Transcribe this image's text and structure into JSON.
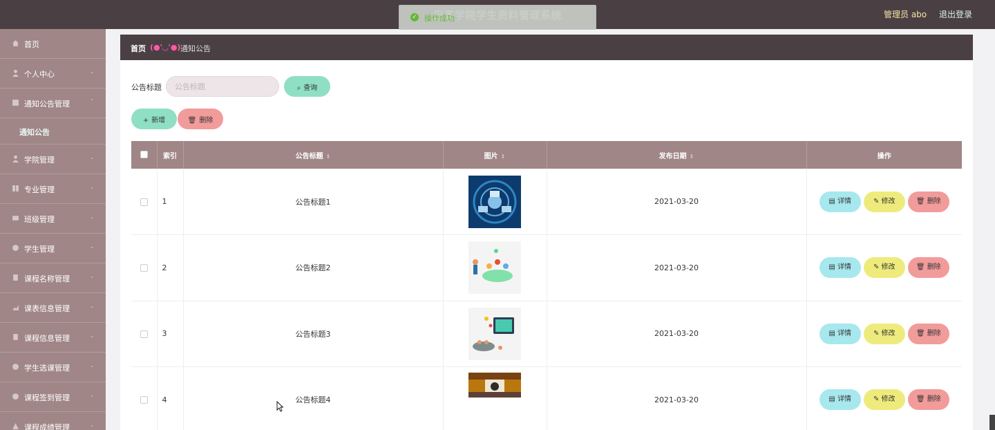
{
  "app": {
    "title": "巴齐学院学生资料管理系统",
    "admin_label": "管理员 abo",
    "logout": "退出登录"
  },
  "toast": {
    "text": "操作成功"
  },
  "sidebar": {
    "items": [
      {
        "label": "首页",
        "icon": "home-icon"
      },
      {
        "label": "个人中心",
        "icon": "user-icon"
      },
      {
        "label": "通知公告管理",
        "icon": "notice-icon"
      },
      {
        "label": "通知公告",
        "sub": true
      },
      {
        "label": "学院管理",
        "icon": "college-icon"
      },
      {
        "label": "专业管理",
        "icon": "grid-icon"
      },
      {
        "label": "班级管理",
        "icon": "class-icon"
      },
      {
        "label": "学生管理",
        "icon": "student-icon"
      },
      {
        "label": "课程名称管理",
        "icon": "course-icon"
      },
      {
        "label": "课表信息管理",
        "icon": "schedule-icon"
      },
      {
        "label": "课程信息管理",
        "icon": "info-icon"
      },
      {
        "label": "学生选课管理",
        "icon": "select-icon"
      },
      {
        "label": "课程签到管理",
        "icon": "signin-icon"
      },
      {
        "label": "课程成绩管理",
        "icon": "score-icon"
      }
    ]
  },
  "breadcrumb": {
    "home": "首页",
    "face": "(●'◡'●)",
    "current": "通知公告"
  },
  "search": {
    "label": "公告标题",
    "placeholder": "公告标题",
    "query_button": "查询"
  },
  "toolbar": {
    "add_label": "新增",
    "delete_label": "删除"
  },
  "table": {
    "headers": {
      "index": "索引",
      "title": "公告标题",
      "image": "图片",
      "date": "发布日期",
      "actions": "操作"
    },
    "rows": [
      {
        "index": "1",
        "title": "公告标题1",
        "date": "2021-03-20",
        "image": "network-illustration"
      },
      {
        "index": "2",
        "title": "公告标题2",
        "date": "2021-03-20",
        "image": "classroom-illustration"
      },
      {
        "index": "3",
        "title": "公告标题3",
        "date": "2021-03-20",
        "image": "lecture-illustration"
      },
      {
        "index": "4",
        "title": "公告标题4",
        "date": "2021-03-20",
        "image": "meeting-photo"
      }
    ],
    "actions": {
      "detail": "详情",
      "edit": "修改",
      "delete": "删除"
    }
  },
  "colors": {
    "topbar": "#4a4044",
    "sidebar": "#a08686",
    "mint": "#8fdfc5",
    "pink": "#f29b9b",
    "cyan": "#a7e8ee",
    "yellow": "#eeeb7c"
  }
}
